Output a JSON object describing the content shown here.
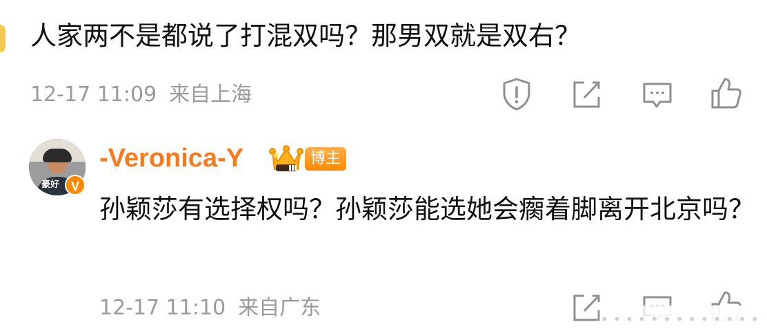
{
  "previous_comment": {
    "text": "人家两不是都说了打混双吗？那男双就是双右？",
    "date": "12-17 11:09",
    "location": "来自上海"
  },
  "reply": {
    "username": "-Veronica-Y",
    "avatar_caption": "豪好",
    "verified_badge": "V",
    "badge_label": "博主",
    "text": "孙颖莎有选择权吗？孙颖莎能选她会瘸着脚离开北京吗？",
    "date": "12-17 11:10",
    "location": "来自广东"
  },
  "watermark": {
    "text": "• • • • • • • • • • • • •"
  },
  "colors": {
    "username": "#f47b1f",
    "meta": "#9a9a9a",
    "icon": "#8f8f8f",
    "badge": "#ff8a00"
  },
  "icons": [
    "report-icon",
    "share-icon",
    "comment-icon",
    "like-icon"
  ]
}
